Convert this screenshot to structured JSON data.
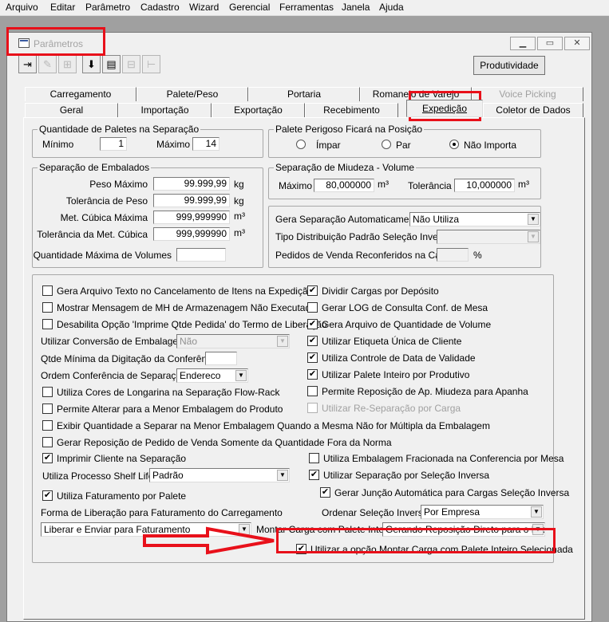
{
  "menu": [
    "Arquivo",
    "Editar",
    "Parâmetro",
    "Cadastro",
    "Wizard",
    "Gerencial",
    "Ferramentas",
    "Janela",
    "Ajuda"
  ],
  "window": {
    "title": "Parâmetros"
  },
  "toolbar": {
    "produtividade": "Produtividade"
  },
  "tabs_row1": [
    "Carregamento",
    "Palete/Peso",
    "Portaria",
    "Romaneio de Varejo",
    "Voice Picking"
  ],
  "tabs_row2": [
    "Geral",
    "Importação",
    "Exportação",
    "Recebimento",
    "Expedição",
    "Coletor de Dados"
  ],
  "qtd_paletes": {
    "title": "Quantidade de Paletes na Separação",
    "min_label": "Mínimo",
    "min_value": "1",
    "max_label": "Máximo",
    "max_value": "14"
  },
  "palete_perigoso": {
    "title": "Palete Perigoso Ficará na Posição",
    "opt1": "Ímpar",
    "opt2": "Par",
    "opt3": "Não Importa"
  },
  "sep_embalados": {
    "title": "Separação de Embalados",
    "peso_max_label": "Peso Máximo",
    "peso_max": "99.999,99",
    "peso_max_unit": "kg",
    "tol_peso_label": "Tolerância de Peso",
    "tol_peso": "99.999,99",
    "tol_peso_unit": "kg",
    "cub_max_label": "Met. Cúbica Máxima",
    "cub_max": "999,999990",
    "cub_max_unit": "m³",
    "tol_cub_label": "Tolerância da Met. Cúbica",
    "tol_cub": "999,999990",
    "tol_cub_unit": "m³",
    "qtd_vol_label": "Quantidade Máxima de Volumes",
    "qtd_vol": ""
  },
  "sep_miudeza": {
    "title": "Separação de Miudeza - Volume",
    "max_label": "Máximo",
    "max": "80,000000",
    "max_unit": "m³",
    "tol_label": "Tolerância",
    "tol": "10,000000",
    "tol_unit": "m³"
  },
  "gera_sep": {
    "gera_label": "Gera Separação Automaticamente",
    "gera_value": "Não Utiliza",
    "tipo_label": "Tipo Distribuição Padrão Seleção Inversa",
    "tipo_value": "",
    "ped_label": "Pedidos de Venda Reconferidos na Carga",
    "ped_value": "",
    "ped_unit": "%"
  },
  "options": {
    "l1": "Gera Arquivo Texto no Cancelamento de Itens na Expedição",
    "l2": "Mostrar Mensagem de MH de Armazenagem Não Executada",
    "l3": "Desabilita Opção 'Imprime Qtde Pedida' do Termo de Liberação",
    "conv_label": "Utilizar Conversão de Embalagem",
    "conv_value": "Não",
    "qtde_min_label": "Qtde Mínima da Digitação da Conferência",
    "qtde_min_value": "",
    "ordem_label": "Ordem Conferência de Separação",
    "ordem_value": "Endereco",
    "l4": "Utiliza Cores de Longarina na Separação Flow-Rack",
    "l5": "Permite Alterar para a Menor Embalagem do Produto",
    "r1": "Dividir Cargas por Depósito",
    "r2": "Gerar LOG de Consulta Conf. de Mesa",
    "r3": "Gera Arquivo de Quantidade de Volume",
    "r4": "Utilizar Etiqueta Única de Cliente",
    "r5": "Utiliza Controle de Data de Validade",
    "r6": "Utilizar Palete Inteiro por Produtivo",
    "r7": "Permite Reposição de Ap. Miudeza para Apanha",
    "r8": "Utilizar Re-Separação por Carga",
    "w1": "Exibir Quantidade a Separar na Menor Embalagem Quando a Mesma Não for Múltipla da Embalagem",
    "w2": "Gerar Reposição de Pedido de Venda Somente da Quantidade Fora da Norma",
    "l6": "Imprimir Cliente na Separação",
    "shelf_label": "Utiliza Processo Shelf Life",
    "shelf_value": "Padrão",
    "l7": "Utiliza Faturamento por Palete",
    "forma_label": "Forma de Liberação para Faturamento do Carregamento",
    "forma_value": "Liberar e Enviar para Faturamento",
    "r9": "Utiliza Embalagem Fracionada na Conferencia por Mesa",
    "r10": "Utilizar Separação por Seleção Inversa",
    "r11": "Gerar Junção Automática para Cargas Seleção Inversa",
    "ordenar_label": "Ordenar Seleção Inversa",
    "ordenar_value": "Por Empresa",
    "montar_label": "Montar Carga com Palete Inteiro",
    "montar_value": "Gerando Reposição Direto para o Box",
    "r12": "Utilizar a opção Montar Carga com Palete Inteiro Selecionada"
  },
  "check": "✔",
  "colors": {
    "highlight": "#e8101a",
    "background": "#f0f0f0"
  }
}
